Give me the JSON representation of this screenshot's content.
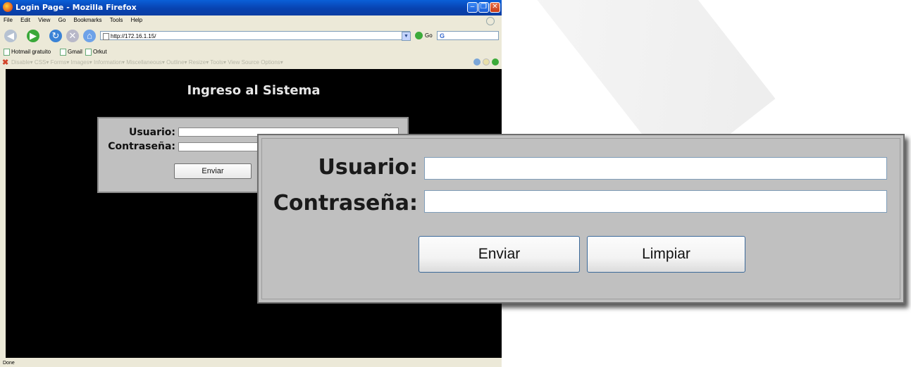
{
  "window": {
    "title": "Login Page - Mozilla Firefox"
  },
  "menu": [
    "File",
    "Edit",
    "View",
    "Go",
    "Bookmarks",
    "Tools",
    "Help"
  ],
  "address": {
    "url": "http://172.16.1.15/",
    "go_label": "Go",
    "search_value": "G"
  },
  "bookmarks": [
    "Hotmail gratuito",
    "Gmail",
    "Orkut"
  ],
  "devbar_items": "Disable▾  CSS▾  Forms▾  Images▾  Information▾  Miscellaneous▾  Outline▾  Resize▾  Tools▾  View Source  Options▾",
  "page": {
    "heading": "Ingreso al Sistema",
    "usuario_label": "Usuario:",
    "password_label": "Contraseña:",
    "submit_label": "Enviar",
    "reset_label": "Limpiar"
  },
  "status": "Done",
  "icons": [
    "firefox-logo",
    "back-arrow",
    "forward-arrow",
    "reload",
    "stop",
    "home",
    "go-arrow",
    "google-search"
  ],
  "colors": {
    "titlebar": "#0842b0",
    "page_bg": "#000000",
    "form_bg": "#c0c0c0"
  }
}
